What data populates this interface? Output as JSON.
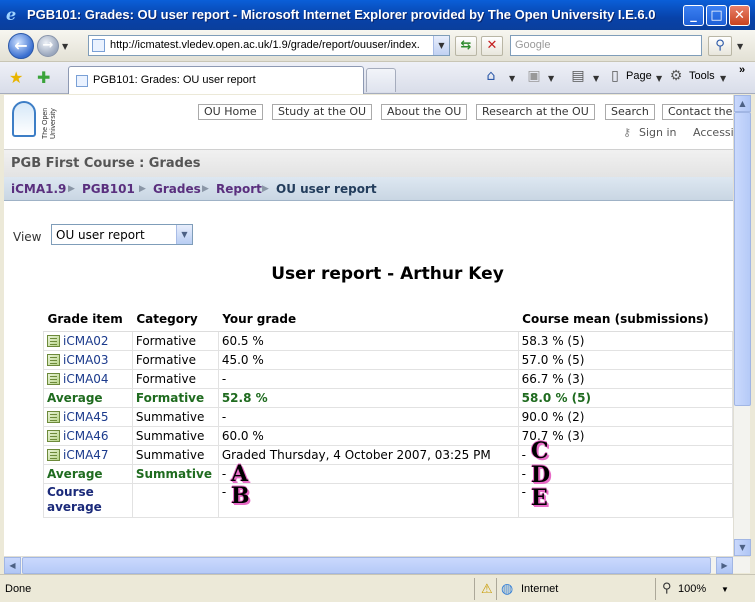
{
  "window": {
    "title": "PGB101: Grades: OU user report - Microsoft Internet Explorer provided by The Open University I.E.6.0"
  },
  "address_bar": {
    "url": "http://icmatest.vledev.open.ac.uk/1.9/grade/report/ouuser/index.",
    "search_placeholder": "Google"
  },
  "tab": {
    "label": "PGB101: Grades: OU user report"
  },
  "command_bar": {
    "page_label": "Page",
    "tools_label": "Tools"
  },
  "site": {
    "logo_text": "The Open University",
    "top_links": [
      "OU Home",
      "Study at the OU",
      "About the OU",
      "Research at the OU",
      "Search",
      "Contact the"
    ],
    "sign_in": "Sign in",
    "accessibility": "Accessi"
  },
  "course_header": "PGB First Course : Grades",
  "breadcrumb": [
    "iCMA1.9",
    "PGB101",
    "Grades",
    "Report",
    "OU user report"
  ],
  "view": {
    "label": "View",
    "selected": "OU user report"
  },
  "report_title": "User report - Arthur Key",
  "table": {
    "headers": [
      "Grade item",
      "Category",
      "Your grade",
      "Course mean (submissions)"
    ],
    "rows": [
      {
        "item": "iCMA02",
        "category": "Formative",
        "grade": "60.5 %",
        "mean": "58.3 % (5)"
      },
      {
        "item": "iCMA03",
        "category": "Formative",
        "grade": "45.0 %",
        "mean": "57.0 % (5)"
      },
      {
        "item": "iCMA04",
        "category": "Formative",
        "grade": "-",
        "mean": "66.7 % (3)"
      },
      {
        "item": "Average",
        "category": "Formative",
        "grade": "52.8 %",
        "mean": "58.0 % (5)"
      },
      {
        "item": "iCMA45",
        "category": "Summative",
        "grade": "-",
        "mean": "90.0 % (2)"
      },
      {
        "item": "iCMA46",
        "category": "Summative",
        "grade": "60.0 %",
        "mean": "70.7 % (3)"
      },
      {
        "item": "iCMA47",
        "category": "Summative",
        "grade": "Graded Thursday, 4 October 2007, 03:25 PM",
        "mean": "-"
      },
      {
        "item": "Average",
        "category": "Summative",
        "grade": "-",
        "mean": "-"
      },
      {
        "item": "Course average",
        "category": "",
        "grade": "-",
        "mean": "-"
      }
    ]
  },
  "markers": [
    "A",
    "B",
    "C",
    "D",
    "E"
  ],
  "status": {
    "left": "Done",
    "zone": "Internet",
    "zoom": "100%"
  }
}
